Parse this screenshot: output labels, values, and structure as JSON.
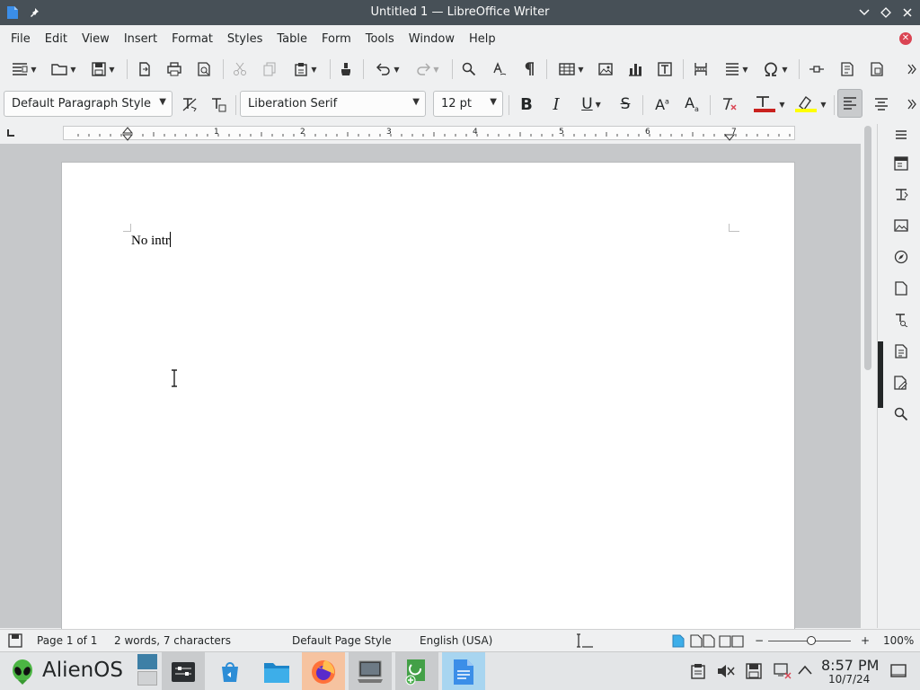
{
  "window": {
    "title": "Untitled 1 — LibreOffice Writer"
  },
  "menu": [
    "File",
    "Edit",
    "View",
    "Insert",
    "Format",
    "Styles",
    "Table",
    "Form",
    "Tools",
    "Window",
    "Help"
  ],
  "formatting": {
    "paragraph_style": "Default Paragraph Style",
    "font_name": "Liberation Serif",
    "font_size": "12 pt"
  },
  "document": {
    "text": "No intr"
  },
  "ruler": {
    "labels": [
      "1",
      "2",
      "3",
      "4",
      "5",
      "6",
      "7"
    ]
  },
  "status": {
    "page": "Page 1 of 1",
    "words": "2 words, 7 characters",
    "page_style": "Default Page Style",
    "language": "English (USA)",
    "zoom_minus": "−",
    "zoom_plus": "+",
    "zoom": "100%"
  },
  "taskbar": {
    "os_name": "AlienOS",
    "time": "8:57 PM",
    "date": "10/7/24"
  },
  "colors": {
    "font_color": "#c9211e",
    "highlight": "#ffff00",
    "accent": "#3daee9"
  }
}
